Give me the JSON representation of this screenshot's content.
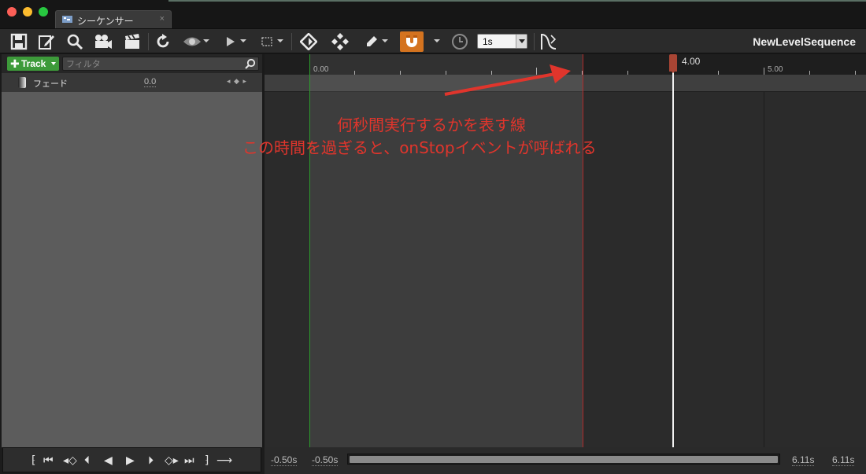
{
  "window": {
    "tab_label": "シーケンサー",
    "tab_close": "×"
  },
  "toolbar": {
    "snap_time": "1s",
    "sequence_name": "NewLevelSequence",
    "icons": [
      "save-icon",
      "edit-icon",
      "search-icon",
      "camera-icon",
      "clapboard-icon",
      "refresh-icon",
      "eye-icon",
      "play-icon",
      "selection-icon",
      "key-icon",
      "keys-icon",
      "pencil-icon",
      "magnet-icon",
      "clock-icon",
      "curve-icon"
    ]
  },
  "outliner": {
    "add_track_label": "Track",
    "filter_placeholder": "フィルタ",
    "tracks": [
      {
        "name": "フェード",
        "value": "0.0",
        "key_nav": "◂ ◆ ▸"
      }
    ]
  },
  "timeline": {
    "ruler_labels": [
      "0.00",
      "5.00"
    ],
    "playhead_time": "4.00",
    "view_start": "-0.50s",
    "working_start": "-0.50s",
    "view_end": "6.11s",
    "working_end": "6.11s"
  },
  "annotation": {
    "line1": "何秒間実行するかを表す線",
    "line2": "この時間を過ぎると、onStopイベントが呼ばれる",
    "color": "#e0352c"
  },
  "transport": {
    "controls": [
      "jump-to-start",
      "step-back-key",
      "prev-key",
      "step-back-frame",
      "play-reverse",
      "play",
      "step-forward-frame",
      "next-key",
      "step-forward-key",
      "jump-to-end",
      "loop"
    ]
  }
}
